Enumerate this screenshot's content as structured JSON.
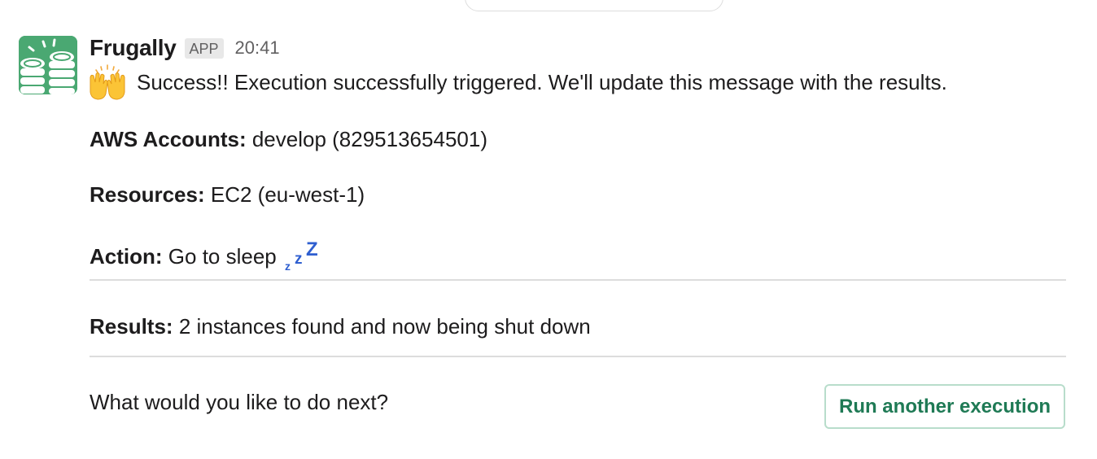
{
  "message": {
    "bot_name": "Frugally",
    "app_badge": "APP",
    "timestamp": "20:41",
    "intro_text": "Success!! Execution successfully triggered. We'll update this message with the results.",
    "aws_accounts": {
      "label": "AWS Accounts:",
      "value": "develop (829513654501)"
    },
    "resources": {
      "label": "Resources:",
      "value": "EC2 (eu-west-1)"
    },
    "action": {
      "label": "Action:",
      "value": "Go to sleep"
    },
    "results": {
      "label": "Results:",
      "value": "2 instances found and now being shut down"
    },
    "next_prompt": "What would you like to do next?",
    "run_button_label": "Run another execution"
  },
  "icons": {
    "avatar": "money-stack-icon",
    "emoji_intro": "raised-hands-icon",
    "emoji_action": "zzz-sleep-icon"
  },
  "colors": {
    "avatar_bg": "#4aa872",
    "button_text": "#1f7a55",
    "button_border": "#b8ddcb",
    "zzz_blue": "#2f5fd0",
    "divider": "#dddddd"
  }
}
